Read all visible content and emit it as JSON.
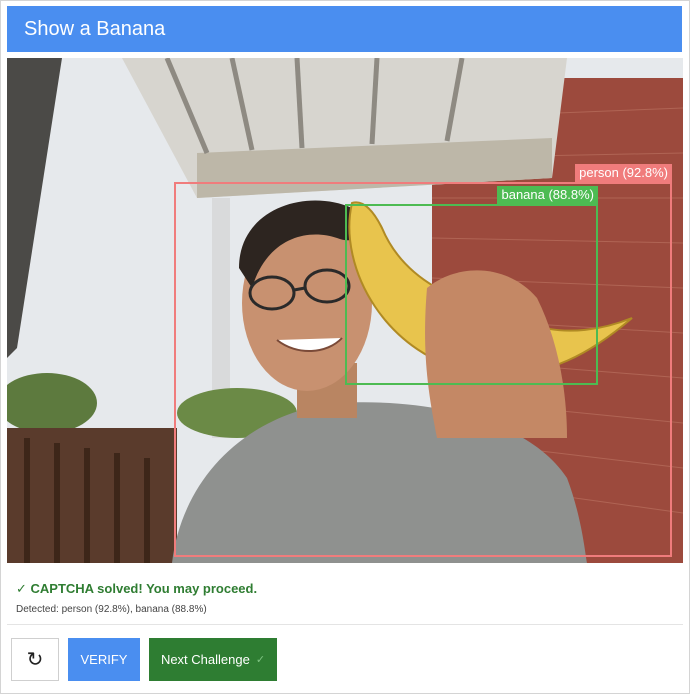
{
  "header": {
    "title": "Show a Banana"
  },
  "detections": [
    {
      "label": "person (92.8%)",
      "color": "#f07c7c"
    },
    {
      "label": "banana (88.8%)",
      "color": "#4dbb52"
    }
  ],
  "status": {
    "message": "✓ CAPTCHA solved! You may proceed.",
    "detected": "Detected: person (92.8%), banana (88.8%)"
  },
  "buttons": {
    "refresh_icon": "↻",
    "verify": "VERIFY",
    "next": "Next Challenge",
    "next_check": "✓"
  },
  "colors": {
    "header": "#4a8ef0",
    "success": "#2e7d32"
  }
}
